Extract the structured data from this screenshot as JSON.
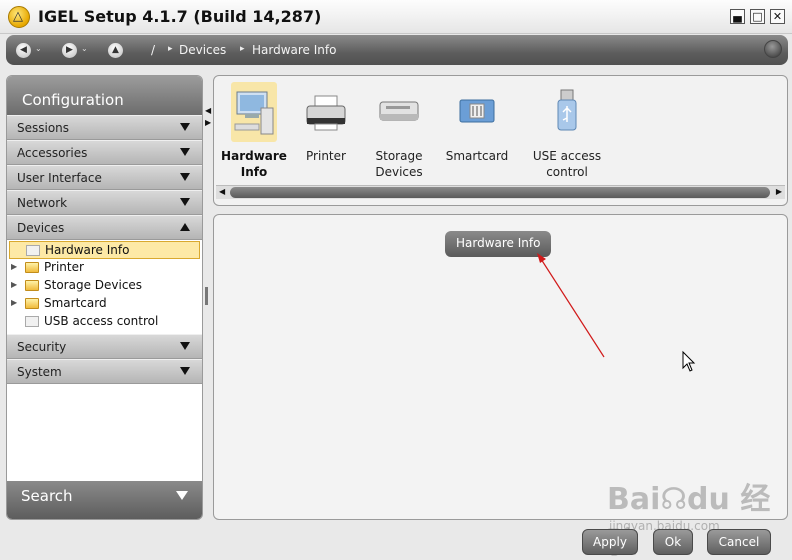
{
  "window": {
    "title": "IGEL Setup 4.1.7 (Build 14,287)",
    "logo_glyph": "△",
    "minimize_glyph": "▄",
    "maximize_glyph": "□",
    "close_glyph": "✕"
  },
  "navbar": {
    "back_glyph": "◀",
    "forward_glyph": "▶",
    "up_glyph": "▲",
    "dropdown_glyph": "⌄",
    "root_label": "/",
    "separator_glyph": "▸",
    "crumbs": [
      "Devices",
      "Hardware Info"
    ]
  },
  "sidebar": {
    "header": "Configuration",
    "sections_top": [
      {
        "label": "Sessions"
      },
      {
        "label": "Accessories"
      },
      {
        "label": "User Interface"
      },
      {
        "label": "Network"
      },
      {
        "label": "Devices"
      }
    ],
    "tree_toggle_glyph": "▶",
    "tree": [
      {
        "label": "Hardware Info",
        "selected": true
      },
      {
        "label": "Printer"
      },
      {
        "label": "Storage Devices"
      },
      {
        "label": "Smartcard"
      },
      {
        "label": "USB access control"
      }
    ],
    "sections_bottom": [
      {
        "label": "Security"
      },
      {
        "label": "System"
      }
    ],
    "search_label": "Search",
    "splitter_left_glyph": "◀",
    "splitter_right_glyph": "▶"
  },
  "categories": [
    {
      "label": "Hardware\nInfo",
      "line1": "Hardware",
      "line2": "Info",
      "icon": "computer-icon",
      "active": true
    },
    {
      "label": "Printer",
      "line1": "Printer",
      "line2": "",
      "icon": "printer-icon"
    },
    {
      "label": "Storage Devices",
      "line1": "Storage",
      "line2": "Devices",
      "icon": "drive-icon"
    },
    {
      "label": "Smartcard",
      "line1": "Smartcard",
      "line2": "",
      "icon": "smartcard-icon"
    },
    {
      "label": "USB access control",
      "line1": "USE access",
      "line2": "control",
      "icon": "usb-icon"
    }
  ],
  "scroll": {
    "left_glyph": "◀",
    "right_glyph": "▶"
  },
  "content": {
    "title": "Hardware Info"
  },
  "buttons": {
    "apply": "Apply",
    "ok": "Ok",
    "cancel": "Cancel"
  },
  "watermark": {
    "text": "Bai☊du 经验",
    "sub": "jingyan.baidu.com"
  },
  "colors": {
    "selected_bg": "#fde9a6",
    "arrow_annotation": "#d11a1a"
  }
}
